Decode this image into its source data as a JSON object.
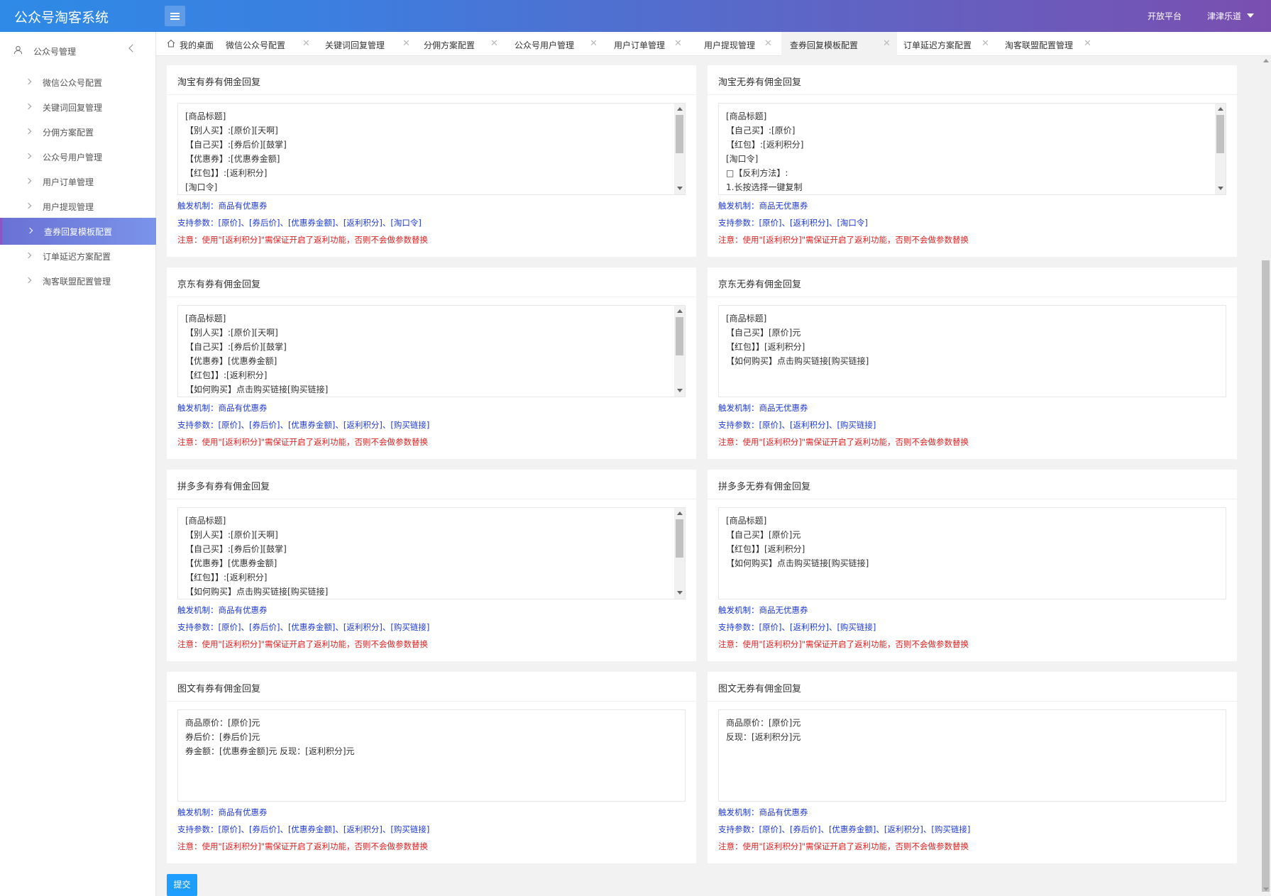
{
  "app": {
    "title": "公众号淘客系统"
  },
  "header": {
    "open_platform": "开放平台",
    "user": "津津乐道"
  },
  "sidebar": {
    "group": "公众号管理",
    "items": [
      {
        "label": "微信公众号配置"
      },
      {
        "label": "关键词回复管理"
      },
      {
        "label": "分佣方案配置"
      },
      {
        "label": "公众号用户管理"
      },
      {
        "label": "用户订单管理"
      },
      {
        "label": "用户提现管理"
      },
      {
        "label": "查券回复模板配置",
        "active": true
      },
      {
        "label": "订单延迟方案配置"
      },
      {
        "label": "淘客联盟配置管理"
      }
    ]
  },
  "tabs": [
    {
      "label": "我的桌面"
    },
    {
      "label": "微信公众号配置"
    },
    {
      "label": "关键词回复管理"
    },
    {
      "label": "分佣方案配置"
    },
    {
      "label": "公众号用户管理"
    },
    {
      "label": "用户订单管理"
    },
    {
      "label": "用户提现管理"
    },
    {
      "label": "查券回复模板配置",
      "active": true
    },
    {
      "label": "订单延迟方案配置"
    },
    {
      "label": "淘客联盟配置管理"
    }
  ],
  "tab_close": "✕",
  "cards": [
    {
      "title": "淘宝有券有佣金回复",
      "lines": [
        "[商品标题]",
        "【别人买】:[原价][天啊]",
        "【自己买】:[券后价][鼓掌]",
        "【优惠券】:[优惠券金额]",
        "【红包】】:[返利积分]",
        "[淘口令]"
      ],
      "trigger": "触发机制：商品有优惠券",
      "params": "支持参数：[原价]、[券后价]、[优惠券金额]、[返利积分]、[淘口令]",
      "warning": "注意：使用\"[返利积分]\"需保证开启了返利功能，否则不会做参数替换"
    },
    {
      "title": "淘宝无券有佣金回复",
      "lines": [
        "[商品标题]",
        "【自己买】:[原价]",
        "【红包】:[返利积分]",
        "[淘口令]",
        "□【反利方法】:",
        "1.长按选择一键复制"
      ],
      "trigger": "触发机制：商品无优惠券",
      "params": "支持参数：[原价]、[返利积分]、[淘口令]",
      "warning": "注意：使用\"[返利积分]\"需保证开启了返利功能，否则不会做参数替换"
    },
    {
      "title": "京东有券有佣金回复",
      "lines": [
        "[商品标题]",
        "【别人买】:[原价][天啊]",
        "【自己买】:[券后价][鼓掌]",
        "【优惠券】[优惠券金额]",
        "【红包】】:[返利积分]",
        "【如何购买】点击购买链接[购买链接]"
      ],
      "trigger": "触发机制：商品有优惠券",
      "params": "支持参数：[原价]、[券后价]、[优惠券金额]、[返利积分]、[购买链接]",
      "warning": "注意：使用\"[返利积分]\"需保证开启了返利功能，否则不会做参数替换"
    },
    {
      "title": "京东无券有佣金回复",
      "lines": [
        "[商品标题]",
        "【自己买】[原价]元",
        "【红包】】[返利积分]",
        "【如何购买】点击购买链接[购买链接]"
      ],
      "trigger": "触发机制：商品无优惠券",
      "params": "支持参数：[原价]、[返利积分]、[购买链接]",
      "warning": "注意：使用\"[返利积分]\"需保证开启了返利功能，否则不会做参数替换"
    },
    {
      "title": "拼多多有券有佣金回复",
      "lines": [
        "[商品标题]",
        "【别人买】:[原价][天啊]",
        "【自己买】:[券后价][鼓掌]",
        "【优惠券】[优惠券金额]",
        "【红包】】:[返利积分]",
        "【如何购买】点击购买链接[购买链接]"
      ],
      "trigger": "触发机制：商品有优惠券",
      "params": "支持参数：[原价]、[券后价]、[优惠券金额]、[返利积分]、[购买链接]",
      "warning": "注意：使用\"[返利积分]\"需保证开启了返利功能，否则不会做参数替换"
    },
    {
      "title": "拼多多无券有佣金回复",
      "lines": [
        "[商品标题]",
        "【自己买】[原价]元",
        "【红包】】[返利积分]",
        "【如何购买】点击购买链接[购买链接]"
      ],
      "trigger": "触发机制：商品无优惠券",
      "params": "支持参数：[原价]、[返利积分]、[购买链接]",
      "warning": "注意：使用\"[返利积分]\"需保证开启了返利功能，否则不会做参数替换"
    },
    {
      "title": "图文有券有佣金回复",
      "lines": [
        "商品原价：[原价]元",
        "券后价：[券后价]元",
        "券金额：[优惠券金额]元 反现：[返利积分]元"
      ],
      "trigger": "触发机制：商品有优惠券",
      "params": "支持参数：[原价]、[券后价]、[优惠券金额]、[返利积分]、[购买链接]",
      "warning": "注意：使用\"[返利积分]\"需保证开启了返利功能，否则不会做参数替换"
    },
    {
      "title": "图文无券有佣金回复",
      "lines": [
        "商品原价：[原价]元",
        "反现：[返利积分]元"
      ],
      "trigger": "触发机制：商品有优惠券",
      "params": "支持参数：[原价]、[券后价]、[优惠券金额]、[返利积分]、[购买链接]",
      "warning": "注意：使用\"[返利积分]\"需保证开启了返利功能，否则不会做参数替换"
    }
  ],
  "submit_label": "提交",
  "colors": {
    "accent": "#1e9fff",
    "param_text": "#1e3ad6",
    "warning_text": "#e02020"
  }
}
